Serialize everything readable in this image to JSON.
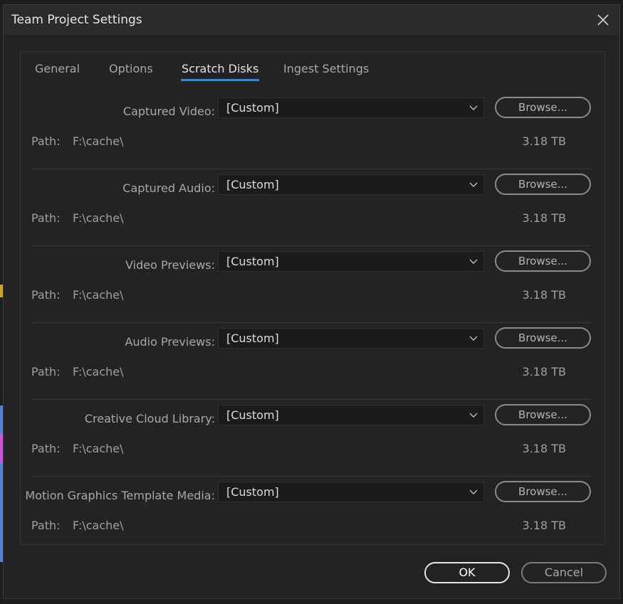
{
  "dialog": {
    "title": "Team Project Settings"
  },
  "tabs": [
    {
      "label": "General",
      "active": false
    },
    {
      "label": "Options",
      "active": false
    },
    {
      "label": "Scratch Disks",
      "active": true
    },
    {
      "label": "Ingest Settings",
      "active": false
    }
  ],
  "path_label": "Path:",
  "browse_label": "Browse...",
  "rows": [
    {
      "label": "Captured Video:",
      "value": "[Custom]",
      "path": "F:\\cache\\",
      "size": "3.18 TB"
    },
    {
      "label": "Captured Audio:",
      "value": "[Custom]",
      "path": "F:\\cache\\",
      "size": "3.18 TB"
    },
    {
      "label": "Video Previews:",
      "value": "[Custom]",
      "path": "F:\\cache\\",
      "size": "3.18 TB"
    },
    {
      "label": "Audio Previews:",
      "value": "[Custom]",
      "path": "F:\\cache\\",
      "size": "3.18 TB"
    },
    {
      "label": "Creative Cloud Library:",
      "value": "[Custom]",
      "path": "F:\\cache\\",
      "size": "3.18 TB"
    },
    {
      "label": "Motion Graphics Template Media:",
      "value": "[Custom]",
      "path": "F:\\cache\\",
      "size": "3.18 TB"
    }
  ],
  "buttons": {
    "ok": "OK",
    "cancel": "Cancel"
  },
  "colors": {
    "accent": "#2d8ceb",
    "background": "#232323",
    "titlebar": "#2b2b2b"
  },
  "icons": {
    "close": "close-icon",
    "dropdown": "chevron-down-icon"
  }
}
